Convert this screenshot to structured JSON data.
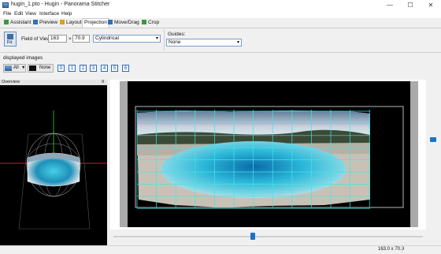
{
  "window": {
    "title": "hugin_1.pto - Hugin - Panorama Stitcher",
    "minimize": "—",
    "maximize": "☐",
    "close": "✕"
  },
  "menu": [
    "File",
    "Edit",
    "View",
    "Interface",
    "Help"
  ],
  "tabs": [
    {
      "label": "Assistant",
      "icon": "assistant-icon",
      "color": "#3a9a3a"
    },
    {
      "label": "Preview",
      "icon": "preview-icon",
      "color": "#2f6fb8"
    },
    {
      "label": "Layout",
      "icon": "layout-icon",
      "color": "#d8a020"
    },
    {
      "label": "Projection",
      "icon": "",
      "color": ""
    },
    {
      "label": "Move/Drag",
      "icon": "move-drag-icon",
      "color": "#2f6fb8"
    },
    {
      "label": "Crop",
      "icon": "crop-icon",
      "color": "#3a9a3a"
    }
  ],
  "active_tab": "Projection",
  "toolbar": {
    "fit_label": "Fit",
    "fov_label": "Field of View:",
    "fov_h": "163",
    "fov_sep": "×",
    "fov_v": "70.9",
    "projection": "Cylindrical",
    "guides_label": "Guides:",
    "guides_value": "None"
  },
  "displayed_images": {
    "label": "displayed images",
    "all_label": "All",
    "none_label": "None",
    "numbers": [
      "0",
      "1",
      "2",
      "3",
      "4",
      "5",
      "6"
    ]
  },
  "overview": {
    "label": "Overview",
    "badge": "9"
  },
  "status": {
    "fov_readout": "163.0 x 70.9"
  },
  "colors": {
    "grid": "#3ee6e6",
    "overview_axis_green": "#2faa2f",
    "overview_axis_red": "#cc2020",
    "slider": "#1a72c8"
  }
}
